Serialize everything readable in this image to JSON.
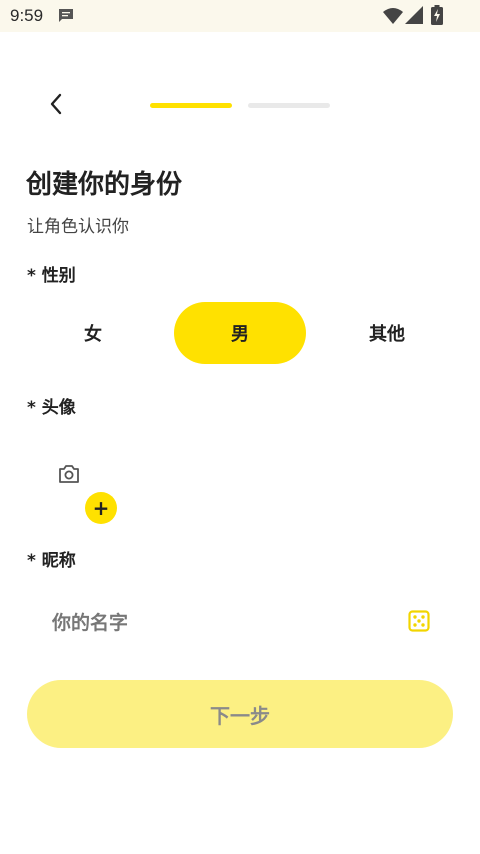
{
  "status_bar": {
    "time": "9:59",
    "icons": [
      "message-icon",
      "wifi-icon",
      "signal-icon",
      "battery-charging-icon"
    ]
  },
  "header": {
    "back_icon": "chevron-left-icon",
    "steps_total": 2,
    "current_step": 1
  },
  "page": {
    "title": "创建你的身份",
    "subtitle": "让角色认识你"
  },
  "gender": {
    "label": "* 性别",
    "options": [
      "女",
      "男",
      "其他"
    ],
    "selected": "男"
  },
  "avatar": {
    "label": "* 头像",
    "icon": "camera-icon",
    "add_symbol": "+"
  },
  "nickname": {
    "label": "* 昵称",
    "placeholder": "你的名字",
    "value": "",
    "random_icon": "dice-icon"
  },
  "next_button": {
    "label": "下一步",
    "enabled": false
  },
  "colors": {
    "accent": "#ffe100",
    "button_disabled_bg": "#fcf083",
    "status_bar_bg": "#fbf8ec"
  }
}
